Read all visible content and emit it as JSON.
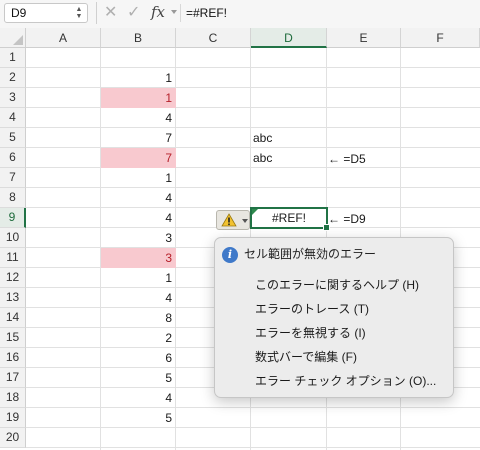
{
  "formula_bar": {
    "name_box": "D9",
    "formula": "=#REF!"
  },
  "grid": {
    "columns": [
      "A",
      "B",
      "C",
      "D",
      "E",
      "F"
    ],
    "rows": [
      "1",
      "2",
      "3",
      "4",
      "5",
      "6",
      "7",
      "8",
      "9",
      "10",
      "11",
      "12",
      "13",
      "14",
      "15",
      "16",
      "17",
      "18",
      "19",
      "20"
    ],
    "b_values": [
      "1",
      "1",
      "4",
      "7",
      "7",
      "1",
      "4",
      "4",
      "3",
      "3",
      "1",
      "4",
      "8",
      "2",
      "6",
      "5",
      "4",
      "5"
    ],
    "d5": "abc",
    "d6": "abc",
    "d9": "#REF!",
    "e6_note": "← =D5",
    "e9_note": "← =D9",
    "highlight_color": "#f8c9cf",
    "highlight_text_color": "#b5202a",
    "selection_color": "#217346"
  },
  "error_menu": {
    "title": "セル範囲が無効のエラー",
    "items": [
      "このエラーに関するヘルプ (H)",
      "エラーのトレース (T)",
      "エラーを無視する (I)",
      "数式バーで編集 (F)",
      "エラー チェック オプション (O)..."
    ]
  }
}
